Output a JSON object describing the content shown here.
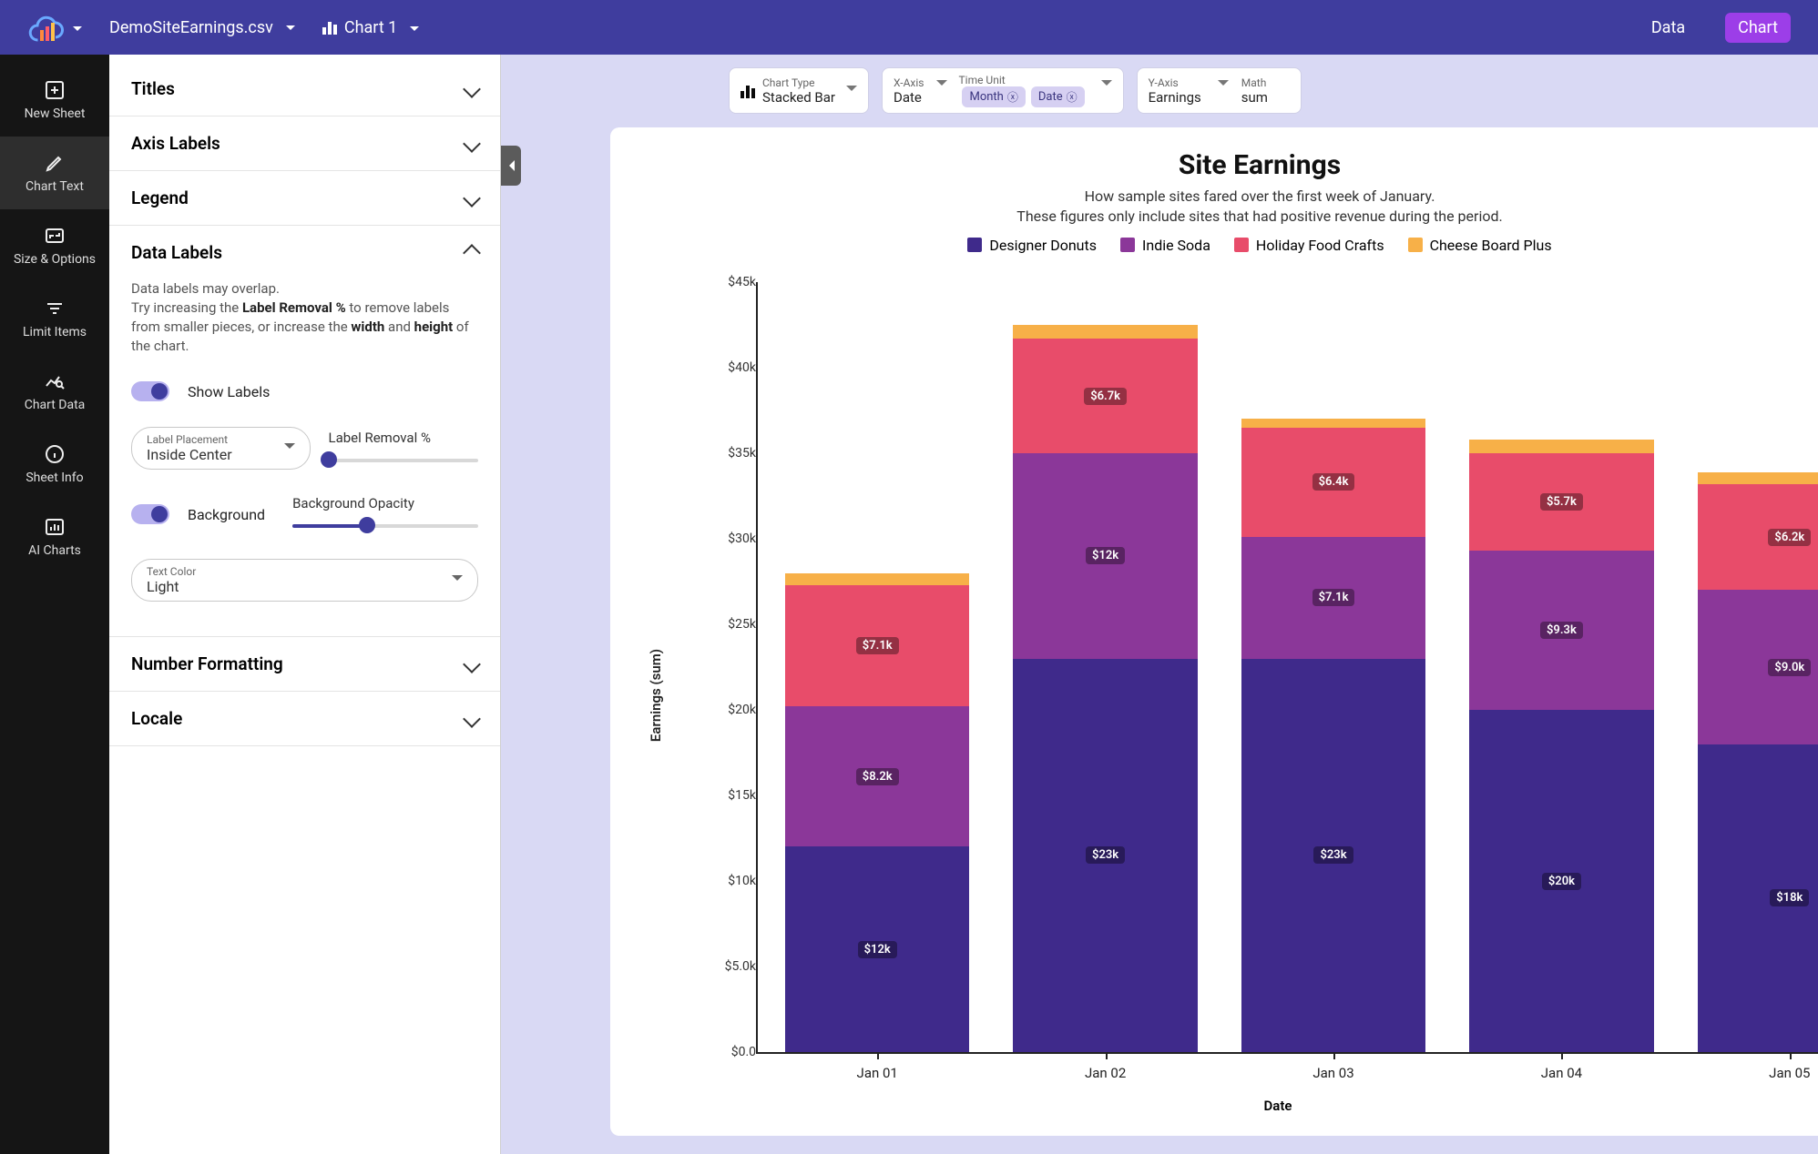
{
  "colors": {
    "header": "#3f3d9e",
    "accent": "#9c3ee8",
    "series": {
      "designer": "#3f2a8b",
      "indie": "#8b3799",
      "holiday": "#e84c6a",
      "cheese": "#f7b048"
    }
  },
  "header": {
    "file_name": "DemoSiteEarnings.csv",
    "chart_name": "Chart 1",
    "tabs": {
      "data": "Data",
      "chart": "Chart"
    }
  },
  "rail": {
    "items": [
      {
        "id": "new-sheet",
        "label": "New Sheet"
      },
      {
        "id": "chart-text",
        "label": "Chart Text"
      },
      {
        "id": "size-options",
        "label": "Size & Options"
      },
      {
        "id": "limit-items",
        "label": "Limit Items"
      },
      {
        "id": "chart-data",
        "label": "Chart Data"
      },
      {
        "id": "sheet-info",
        "label": "Sheet Info"
      },
      {
        "id": "ai-charts",
        "label": "AI Charts"
      }
    ]
  },
  "panel": {
    "sections": {
      "titles": "Titles",
      "axis_labels": "Axis Labels",
      "legend": "Legend",
      "data_labels": "Data Labels",
      "number_formatting": "Number Formatting",
      "locale": "Locale"
    },
    "data_labels": {
      "note_1": "Data labels may overlap.",
      "note_2_pre": "Try increasing the ",
      "note_2_b1": "Label Removal %",
      "note_2_mid": " to remove labels from smaller pieces, or increase the ",
      "note_2_b2": "width",
      "note_2_and": " and ",
      "note_2_b3": "height",
      "note_2_post": " of the chart.",
      "show_labels": "Show Labels",
      "label_placement_label": "Label Placement",
      "label_placement_value": "Inside Center",
      "label_removal_label": "Label Removal %",
      "label_removal_pct": 0,
      "background": "Background",
      "background_opacity_label": "Background Opacity",
      "background_opacity_pct": 40,
      "text_color_label": "Text Color",
      "text_color_value": "Light"
    }
  },
  "config": {
    "chart_type": {
      "label": "Chart Type",
      "value": "Stacked Bar"
    },
    "x_axis": {
      "label": "X-Axis",
      "value": "Date"
    },
    "time_unit": {
      "label": "Time Unit",
      "chips": [
        "Month",
        "Date"
      ]
    },
    "y_axis": {
      "label": "Y-Axis",
      "value": "Earnings"
    },
    "math": {
      "label": "Math",
      "value": "sum"
    }
  },
  "chart_header": {
    "title": "Site Earnings",
    "subtitle_1": "How sample sites fared over the first week of January.",
    "subtitle_2": "These figures only include sites that had positive revenue during the period."
  },
  "legend": [
    {
      "key": "designer",
      "label": "Designer Donuts"
    },
    {
      "key": "indie",
      "label": "Indie Soda"
    },
    {
      "key": "holiday",
      "label": "Holiday Food Crafts"
    },
    {
      "key": "cheese",
      "label": "Cheese Board Plus"
    }
  ],
  "axes": {
    "ylabel": "Earnings (sum)",
    "xlabel": "Date",
    "ymax": 45,
    "yticks": [
      0.0,
      5.0,
      10,
      15,
      20,
      25,
      30,
      35,
      40,
      45
    ],
    "ytick_labels": [
      "$0.0",
      "$5.0k",
      "$10k",
      "$15k",
      "$20k",
      "$25k",
      "$30k",
      "$35k",
      "$40k",
      "$45k"
    ]
  },
  "chart_data": {
    "type": "bar",
    "stacked": true,
    "xlabel": "Date",
    "ylabel": "Earnings (sum)",
    "ylim": [
      0,
      45000
    ],
    "categories": [
      "Jan 01",
      "Jan 02",
      "Jan 03",
      "Jan 04",
      "Jan 05"
    ],
    "series": [
      {
        "name": "Designer Donuts",
        "key": "designer",
        "values": [
          12000,
          23000,
          23000,
          20000,
          18000
        ],
        "labels": [
          "$12k",
          "$23k",
          "$23k",
          "$20k",
          "$18k"
        ]
      },
      {
        "name": "Indie Soda",
        "key": "indie",
        "values": [
          8200,
          12000,
          7100,
          9300,
          9000
        ],
        "labels": [
          "$8.2k",
          "$12k",
          "$7.1k",
          "$9.3k",
          "$9.0k"
        ]
      },
      {
        "name": "Holiday Food Crafts",
        "key": "holiday",
        "values": [
          7100,
          6700,
          6400,
          5700,
          6200
        ],
        "labels": [
          "$7.1k",
          "$6.7k",
          "$6.4k",
          "$5.7k",
          "$6.2k"
        ]
      },
      {
        "name": "Cheese Board Plus",
        "key": "cheese",
        "values": [
          700,
          800,
          500,
          800,
          700
        ],
        "labels": [
          "",
          "",
          "",
          "",
          ""
        ]
      }
    ]
  }
}
